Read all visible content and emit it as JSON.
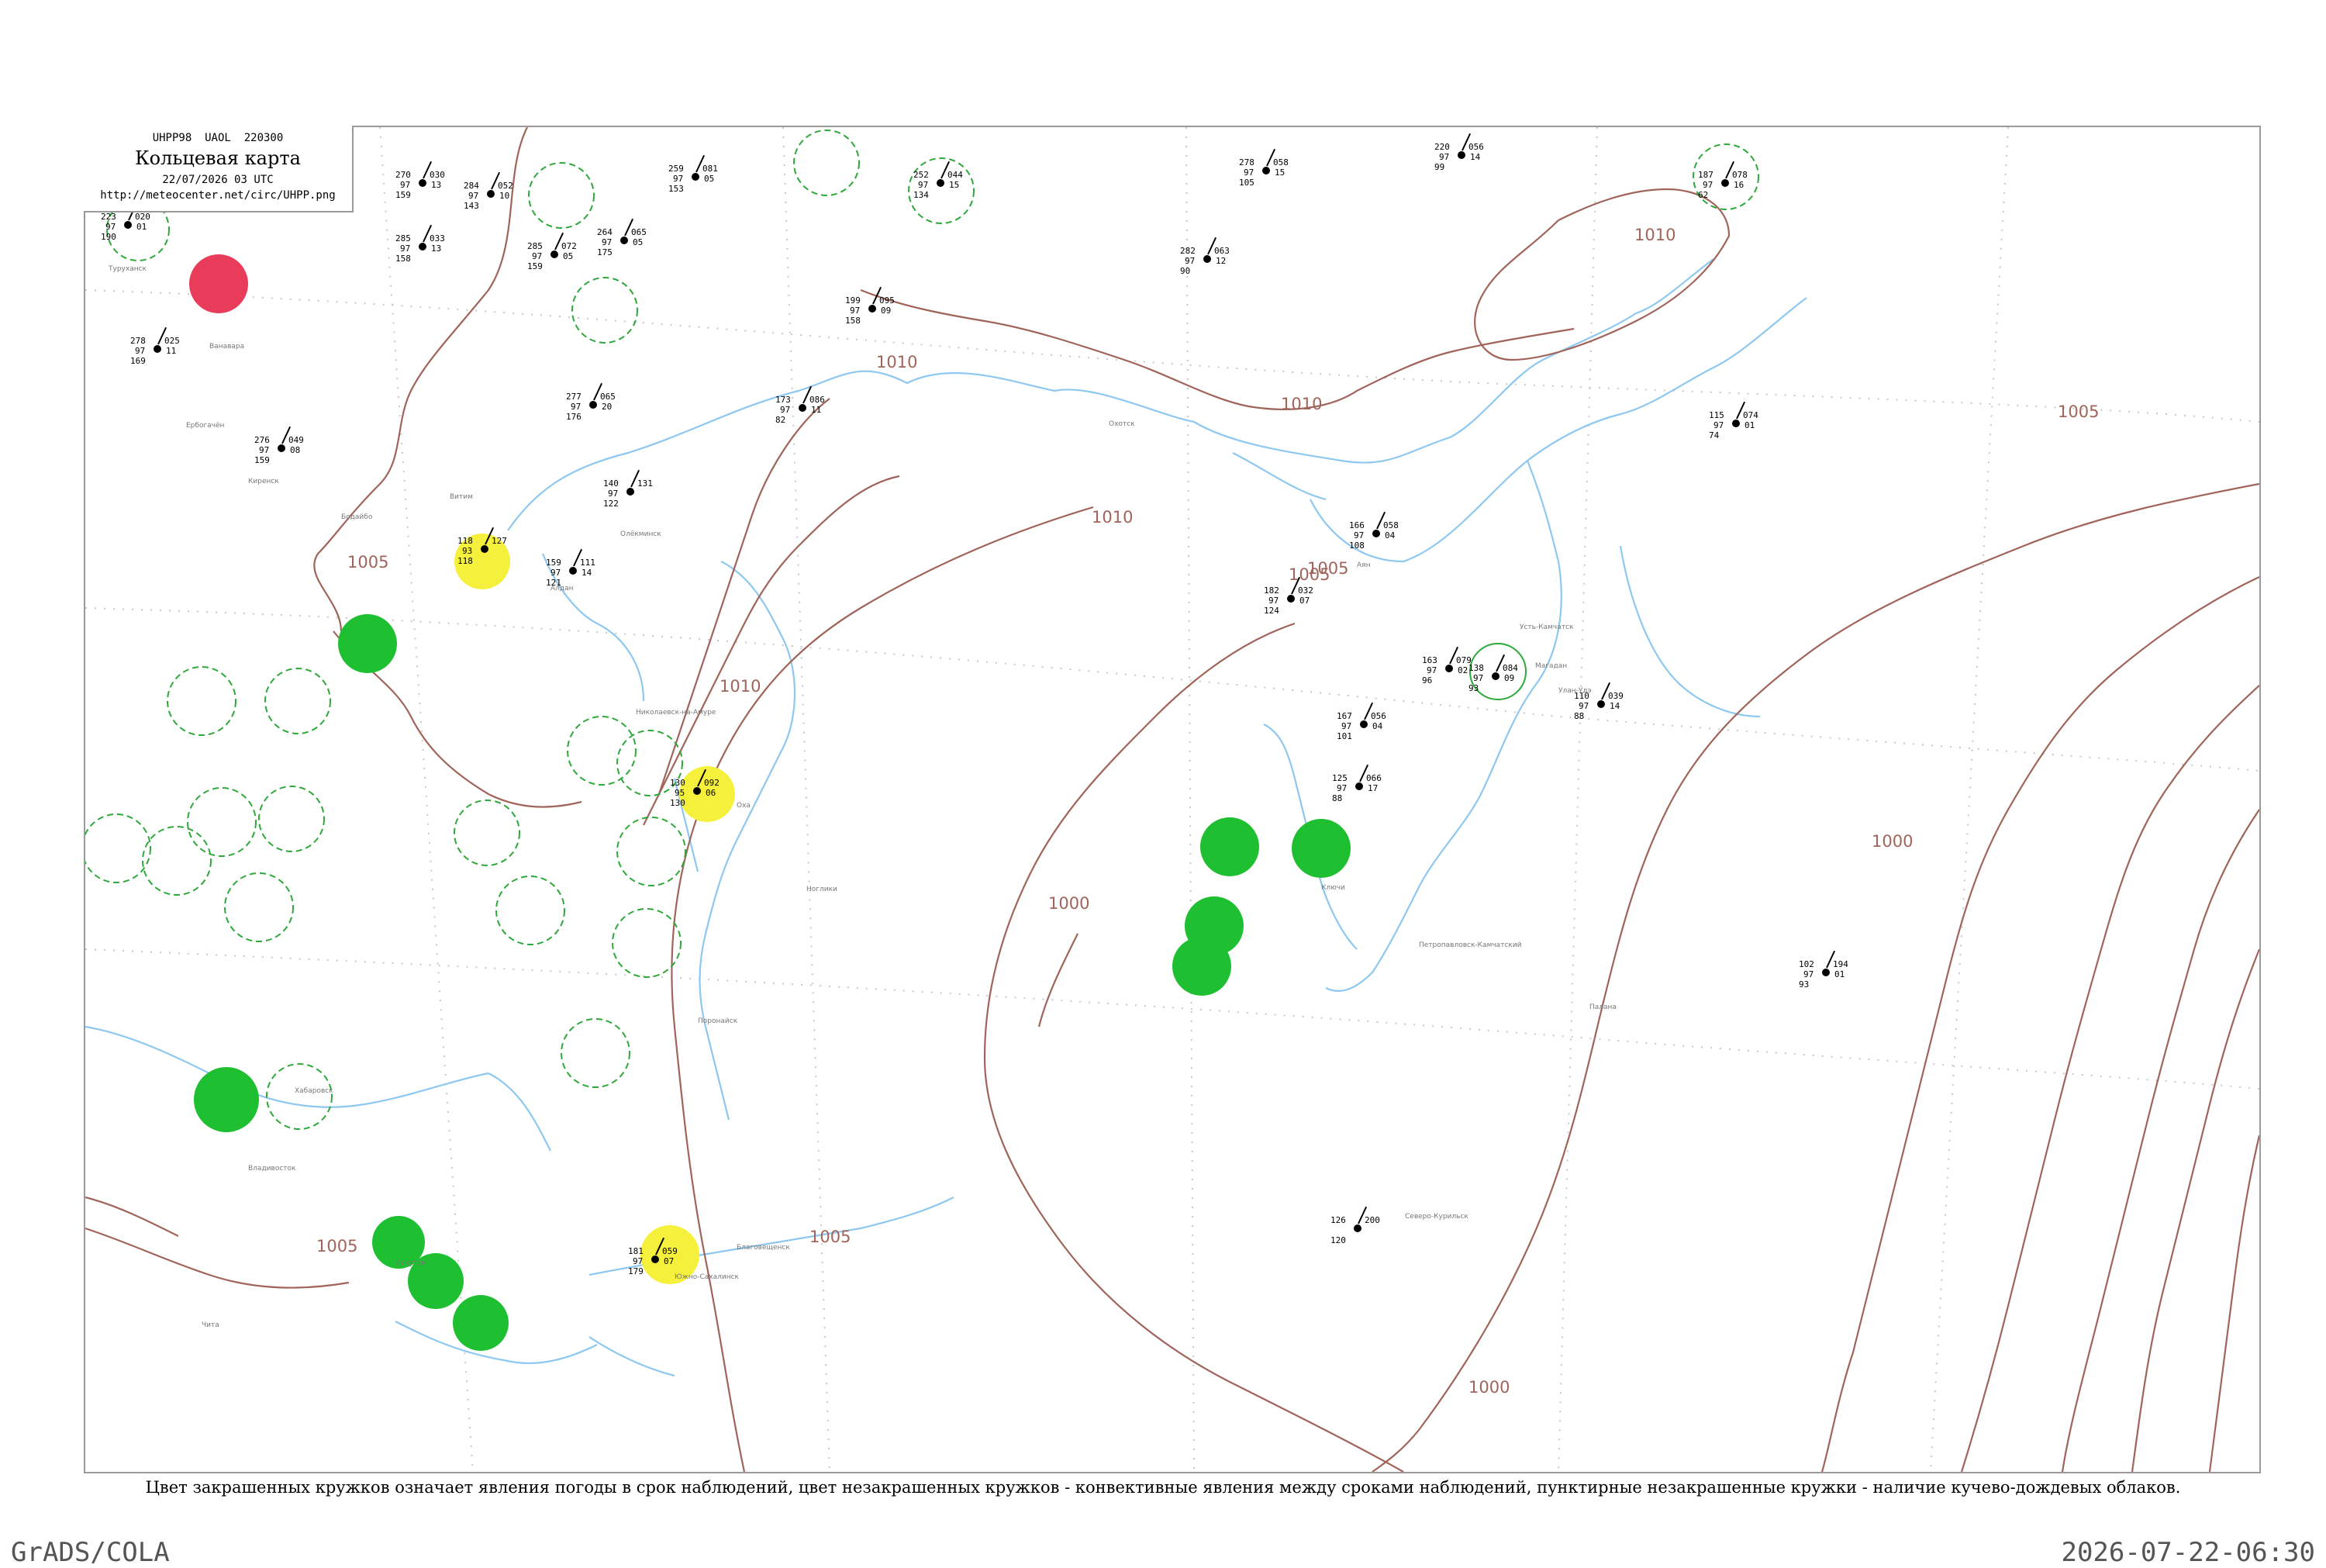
{
  "header": {
    "code_line": "UHPP98  UAOL  220300",
    "title": "Кольцевая карта",
    "date_line": "22/07/2026 03 UTC",
    "url": "http://meteocenter.net/circ/UHPP.png"
  },
  "caption": "Цвет закрашенных кружков означает явления погоды в срок наблюдений, цвет незакрашенных кружков - конвективные явления между сроками наблюдений, пунктирные незакрашенные кружки - наличие кучево-дождевых облаков.",
  "footer": {
    "left": "GrADS/COLA",
    "right": "2026-07-22-06:30"
  },
  "colors": {
    "isobar": "#a0645a",
    "coast": "#8ec8f0",
    "circle_green": "#1fbf32",
    "circle_yellow": "#f5f03c",
    "circle_red": "#e83c5a",
    "circle_dash": "#2ea83a",
    "grid_dot": "#bbbbbb"
  },
  "isobar_labels": [
    "1010",
    "1010",
    "1010",
    "1010",
    "1005",
    "1005",
    "1005",
    "1005",
    "1005",
    "1000",
    "1000",
    "1000",
    "1010",
    "1005"
  ],
  "stations": [
    {
      "pressure": "020",
      "temp": "223",
      "dew": "190",
      "dp": "01",
      "code": "97"
    },
    {
      "pressure": "052",
      "temp": "284",
      "dew": "143",
      "dp": "10",
      "code": "97"
    },
    {
      "pressure": "030",
      "temp": "270",
      "dew": "159",
      "dp": "13",
      "code": "97"
    },
    {
      "pressure": "033",
      "temp": "285",
      "dew": "158",
      "dp": "13",
      "code": "97"
    },
    {
      "pressure": "065",
      "temp": "264",
      "dew": "175",
      "dp": "05",
      "code": "97"
    },
    {
      "pressure": "072",
      "temp": "285",
      "dew": "159",
      "dp": "05",
      "code": "97"
    },
    {
      "pressure": "081",
      "temp": "259",
      "dew": "153",
      "dp": "05",
      "code": "97"
    },
    {
      "pressure": "044",
      "temp": "252",
      "dew": "134",
      "dp": "15",
      "code": "97"
    },
    {
      "pressure": "058",
      "temp": "278",
      "dew": "105",
      "dp": "15",
      "code": "97"
    },
    {
      "pressure": "056",
      "temp": "220",
      "dew": "99",
      "dp": "14",
      "code": "97"
    },
    {
      "pressure": "078",
      "temp": "187",
      "dew": "62",
      "dp": "16",
      "code": "97"
    },
    {
      "pressure": "063",
      "temp": "282",
      "dew": "90",
      "dp": "12",
      "code": "97"
    },
    {
      "pressure": "095",
      "temp": "199",
      "dew": "158",
      "dp": "09",
      "code": "97"
    },
    {
      "pressure": "086",
      "temp": "173",
      "dew": "82",
      "dp": "11",
      "code": "97"
    },
    {
      "pressure": "074",
      "temp": "115",
      "dew": "74",
      "dp": "01",
      "code": "97"
    },
    {
      "pressure": "025",
      "temp": "278",
      "dew": "169",
      "dp": "11",
      "code": "97"
    },
    {
      "pressure": "049",
      "temp": "276",
      "dew": "159",
      "dp": "08",
      "code": "97"
    },
    {
      "pressure": "065",
      "temp": "277",
      "dew": "176",
      "dp": "20",
      "code": "97"
    },
    {
      "pressure": "131",
      "temp": "140",
      "dew": "122",
      "dp": "",
      "code": "97"
    },
    {
      "pressure": "127",
      "temp": "118",
      "dew": "118",
      "dp": "",
      "code": "93"
    },
    {
      "pressure": "111",
      "temp": "159",
      "dew": "121",
      "dp": "14",
      "code": "97"
    },
    {
      "pressure": "058",
      "temp": "166",
      "dew": "108",
      "dp": "04",
      "code": "97"
    },
    {
      "pressure": "032",
      "temp": "182",
      "dew": "124",
      "dp": "07",
      "code": "97"
    },
    {
      "pressure": "079",
      "temp": "163",
      "dew": "96",
      "dp": "02",
      "code": "97"
    },
    {
      "pressure": "084",
      "temp": "138",
      "dew": "93",
      "dp": "09",
      "code": "97"
    },
    {
      "pressure": "039",
      "temp": "110",
      "dew": "88",
      "dp": "14",
      "code": "97"
    },
    {
      "pressure": "056",
      "temp": "167",
      "dew": "101",
      "dp": "04",
      "code": "97"
    },
    {
      "pressure": "066",
      "temp": "125",
      "dew": "88",
      "dp": "17",
      "code": "97"
    },
    {
      "pressure": "092",
      "temp": "130",
      "dew": "130",
      "dp": "06",
      "code": "95"
    },
    {
      "pressure": "059",
      "temp": "181",
      "dew": "179",
      "dp": "07",
      "code": "97"
    },
    {
      "pressure": "194",
      "temp": "102",
      "dew": "93",
      "dp": "01",
      "code": "97"
    },
    {
      "pressure": "200",
      "temp": "126",
      "dew": "120",
      "dp": "",
      "code": ""
    }
  ],
  "place_names": [
    "Туруханск",
    "Ванавара",
    "Ербогачён",
    "Киренск",
    "Бодайбо",
    "Витим",
    "Олёкминск",
    "Алдан",
    "Охотск",
    "Аян",
    "Магадан",
    "Николаевск-на-Амуре",
    "Оха",
    "Ноглики",
    "Поронайск",
    "Южно-Сахалинск",
    "Хабаровск",
    "Владивосток",
    "Благовещенск",
    "Чита",
    "Иркутск",
    "Улан-Удэ",
    "Усть-Камчатск",
    "Ключи",
    "Петропавловск-Камчатский",
    "Северо-Курильск",
    "Палана"
  ]
}
